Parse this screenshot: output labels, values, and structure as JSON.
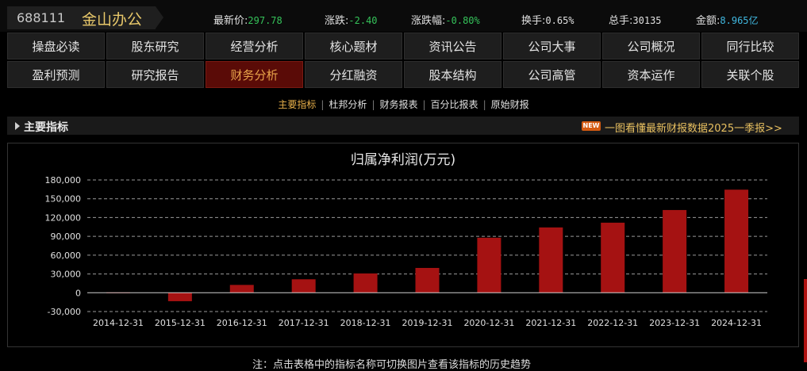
{
  "stock": {
    "code": "688111",
    "name": "金山办公"
  },
  "quote": [
    {
      "label": "最新价:",
      "value": "297.78",
      "color": "#35c35a"
    },
    {
      "label": "涨跌:",
      "value": "-2.40",
      "color": "#35c35a"
    },
    {
      "label": "涨跌幅:",
      "value": "-0.80%",
      "color": "#35c35a"
    },
    {
      "label": "换手:",
      "value": "0.65%",
      "color": "#e0e0e0"
    },
    {
      "label": "总手:",
      "value": "30135",
      "color": "#e0e0e0"
    },
    {
      "label": "金额:",
      "value": "8.965亿",
      "color": "#40b8e0"
    }
  ],
  "tabs_row1": [
    "操盘必读",
    "股东研究",
    "经营分析",
    "核心题材",
    "资讯公告",
    "公司大事",
    "公司概况",
    "同行比较"
  ],
  "tabs_row2": [
    "盈利预测",
    "研究报告",
    "财务分析",
    "分红融资",
    "股本结构",
    "公司高管",
    "资本运作",
    "关联个股"
  ],
  "active_tab": "财务分析",
  "subnav": [
    "主要指标",
    "杜邦分析",
    "财务报表",
    "百分比报表",
    "原始财报"
  ],
  "subnav_active": "主要指标",
  "section": {
    "title": "主要指标",
    "new_badge": "NEW",
    "promo": "一图看懂最新财报数据2025一季报>>"
  },
  "chart_data": {
    "type": "bar",
    "title": "归属净利润(万元)",
    "categories": [
      "2014-12-31",
      "2015-12-31",
      "2016-12-31",
      "2017-12-31",
      "2018-12-31",
      "2019-12-31",
      "2020-12-31",
      "2021-12-31",
      "2022-12-31",
      "2023-12-31",
      "2024-12-31"
    ],
    "values": [
      500,
      -13500,
      12500,
      21500,
      30800,
      39600,
      87800,
      104200,
      111800,
      132000,
      164500
    ],
    "yticks": [
      "180,000",
      "150,000",
      "120,000",
      "90,000",
      "60,000",
      "30,000",
      "0",
      "-30,000"
    ],
    "ylim": [
      -30000,
      180000
    ],
    "grid": true,
    "bar_color": "#a51212"
  },
  "footnote": "注：点击表格中的指标名称可切换图片查看该指标的历史趋势"
}
